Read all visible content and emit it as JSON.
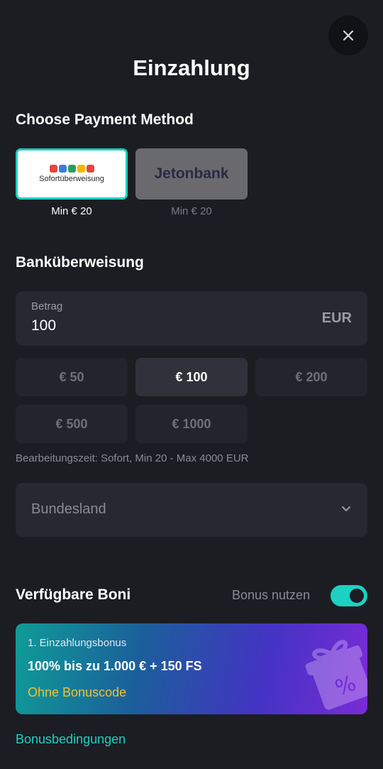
{
  "header": {
    "title": "Einzahlung",
    "close_icon": "close-icon"
  },
  "payment": {
    "section_title": "Choose Payment Method",
    "methods": [
      {
        "name": "Sofortüberweisung",
        "min": "Min € 20",
        "selected": true
      },
      {
        "name": "Jetonbank",
        "min": "Min € 20",
        "selected": false
      }
    ]
  },
  "bank_transfer": {
    "section_title": "Banküberweisung",
    "amount_label": "Betrag",
    "amount_value": "100",
    "currency": "EUR",
    "quick_amounts": [
      {
        "label": "€ 50",
        "active": false
      },
      {
        "label": "€ 100",
        "active": true
      },
      {
        "label": "€ 200",
        "active": false
      },
      {
        "label": "€ 500",
        "active": false
      },
      {
        "label": "€ 1000",
        "active": false
      }
    ],
    "processing_info": "Bearbeitungszeit: Sofort, Min 20 - Max 4000 EUR",
    "state_select_placeholder": "Bundesland"
  },
  "bonus": {
    "section_title": "Verfügbare Boni",
    "toggle_label": "Bonus nutzen",
    "toggle_on": true,
    "card": {
      "number": "1. Einzahlungsbonus",
      "offer": "100% bis zu 1.000 € + 150 FS",
      "code_text": "Ohne Bonuscode"
    },
    "terms_link": "Bonusbedingungen"
  },
  "colors": {
    "accent": "#1cd1c1",
    "background": "#1c1d23",
    "bonus_code": "#f2c230"
  }
}
